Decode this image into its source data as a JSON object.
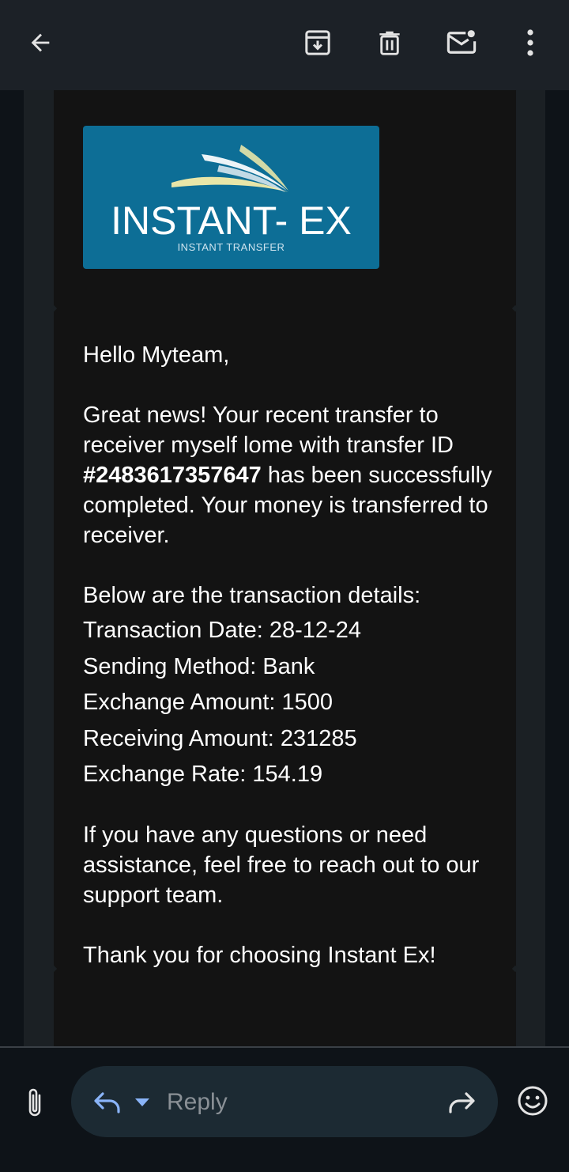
{
  "toolbar": {
    "back_icon": "arrow-left-icon",
    "archive_icon": "archive-icon",
    "delete_icon": "trash-icon",
    "mark_unread_icon": "mail-unread-icon",
    "more_icon": "more-vertical-icon"
  },
  "logo": {
    "main": "INSTANT- EX",
    "sub": "INSTANT TRANSFER"
  },
  "email": {
    "greeting": "Hello Myteam,",
    "para1_before": "Great news! Your recent transfer to receiver myself lome with transfer ID ",
    "transfer_id": "#2483617357647",
    "para1_after": " has been successfully completed. Your money is transferred to receiver.",
    "details_intro": "Below are the transaction details:",
    "details": [
      "Transaction Date: 28-12-24",
      "Sending Method: Bank",
      "Exchange Amount: 1500",
      "Receiving Amount: 231285",
      "Exchange Rate: 154.19"
    ],
    "support": "If you have any questions or need assistance, feel free to reach out to our support team.",
    "closing": "Thank you for choosing Instant Ex!"
  },
  "bottom_bar": {
    "reply_placeholder": "Reply",
    "attach_icon": "paperclip-icon",
    "reply_icon": "reply-icon",
    "dropdown_icon": "caret-down-icon",
    "forward_icon": "forward-icon",
    "emoji_icon": "emoji-icon"
  },
  "colors": {
    "logo_bg": "#0d6e96",
    "reply_pill": "#1c2a33",
    "accent_blue": "#8ab4f8"
  }
}
